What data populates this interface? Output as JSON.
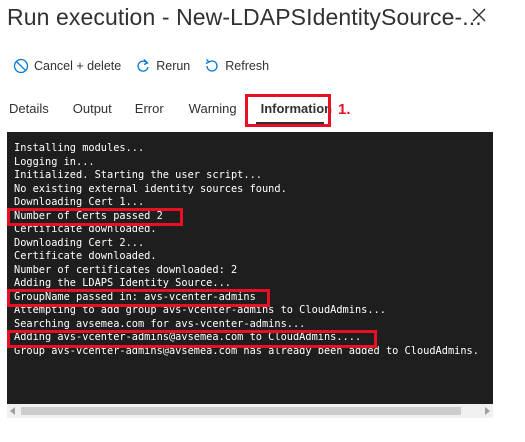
{
  "window": {
    "title": "Run execution - New-LDAPSIdentitySource-..."
  },
  "toolbar": {
    "cancel_label": "Cancel + delete",
    "rerun_label": "Rerun",
    "refresh_label": "Refresh"
  },
  "tabs": [
    {
      "label": "Details"
    },
    {
      "label": "Output"
    },
    {
      "label": "Error"
    },
    {
      "label": "Warning"
    },
    {
      "label": "Information",
      "active": true
    }
  ],
  "annotation": {
    "step": "1.",
    "color": "#e81123"
  },
  "console": {
    "lines": [
      "Installing modules...",
      "Logging in...",
      "Initialized. Starting the user script...",
      "No existing external identity sources found.",
      "Downloading Cert 1...",
      "Number of Certs passed 2",
      "Certificate downloaded.",
      "Downloading Cert 2...",
      "Certificate downloaded.",
      "Number of certificates downloaded: 2",
      "Adding the LDAPS Identity Source...",
      "GroupName passed in: avs-vcenter-admins",
      "Attempting to add group avs-vcenter-admins to CloudAdmins...",
      "Searching avsemea.com for avs-vcenter-admins...",
      "Adding avs-vcenter-admins@avsemea.com to CloudAdmins....",
      "Group avs-vcenter-admins@avsemea.com has already been added to CloudAdmins."
    ]
  },
  "colors": {
    "console_bg": "#1e1e1e",
    "accent_blue": "#0078d4",
    "highlight": "#e81123"
  }
}
